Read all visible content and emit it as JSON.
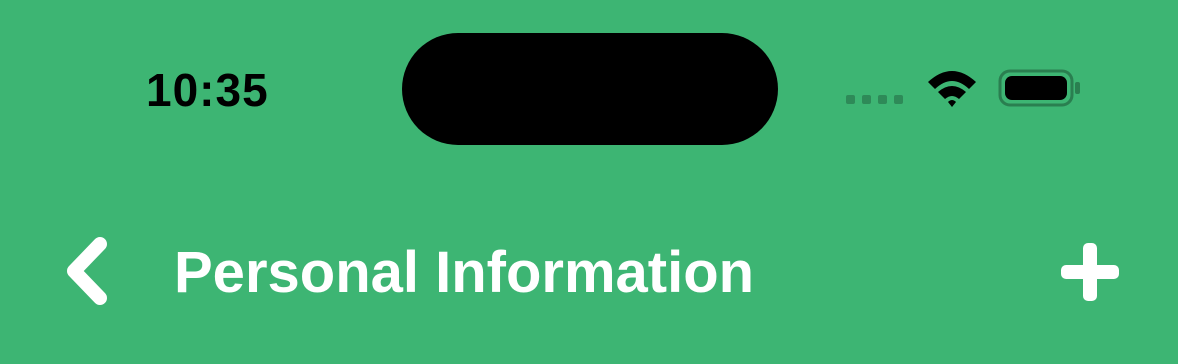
{
  "status_bar": {
    "time": "10:35",
    "icons": [
      "cellular-signal-icon",
      "wifi-icon",
      "battery-icon"
    ]
  },
  "nav": {
    "title": "Personal Information",
    "back_icon": "chevron-left-icon",
    "add_icon": "plus-icon"
  },
  "colors": {
    "background": "#3db573",
    "title": "#ffffff",
    "status_text": "#000000"
  }
}
